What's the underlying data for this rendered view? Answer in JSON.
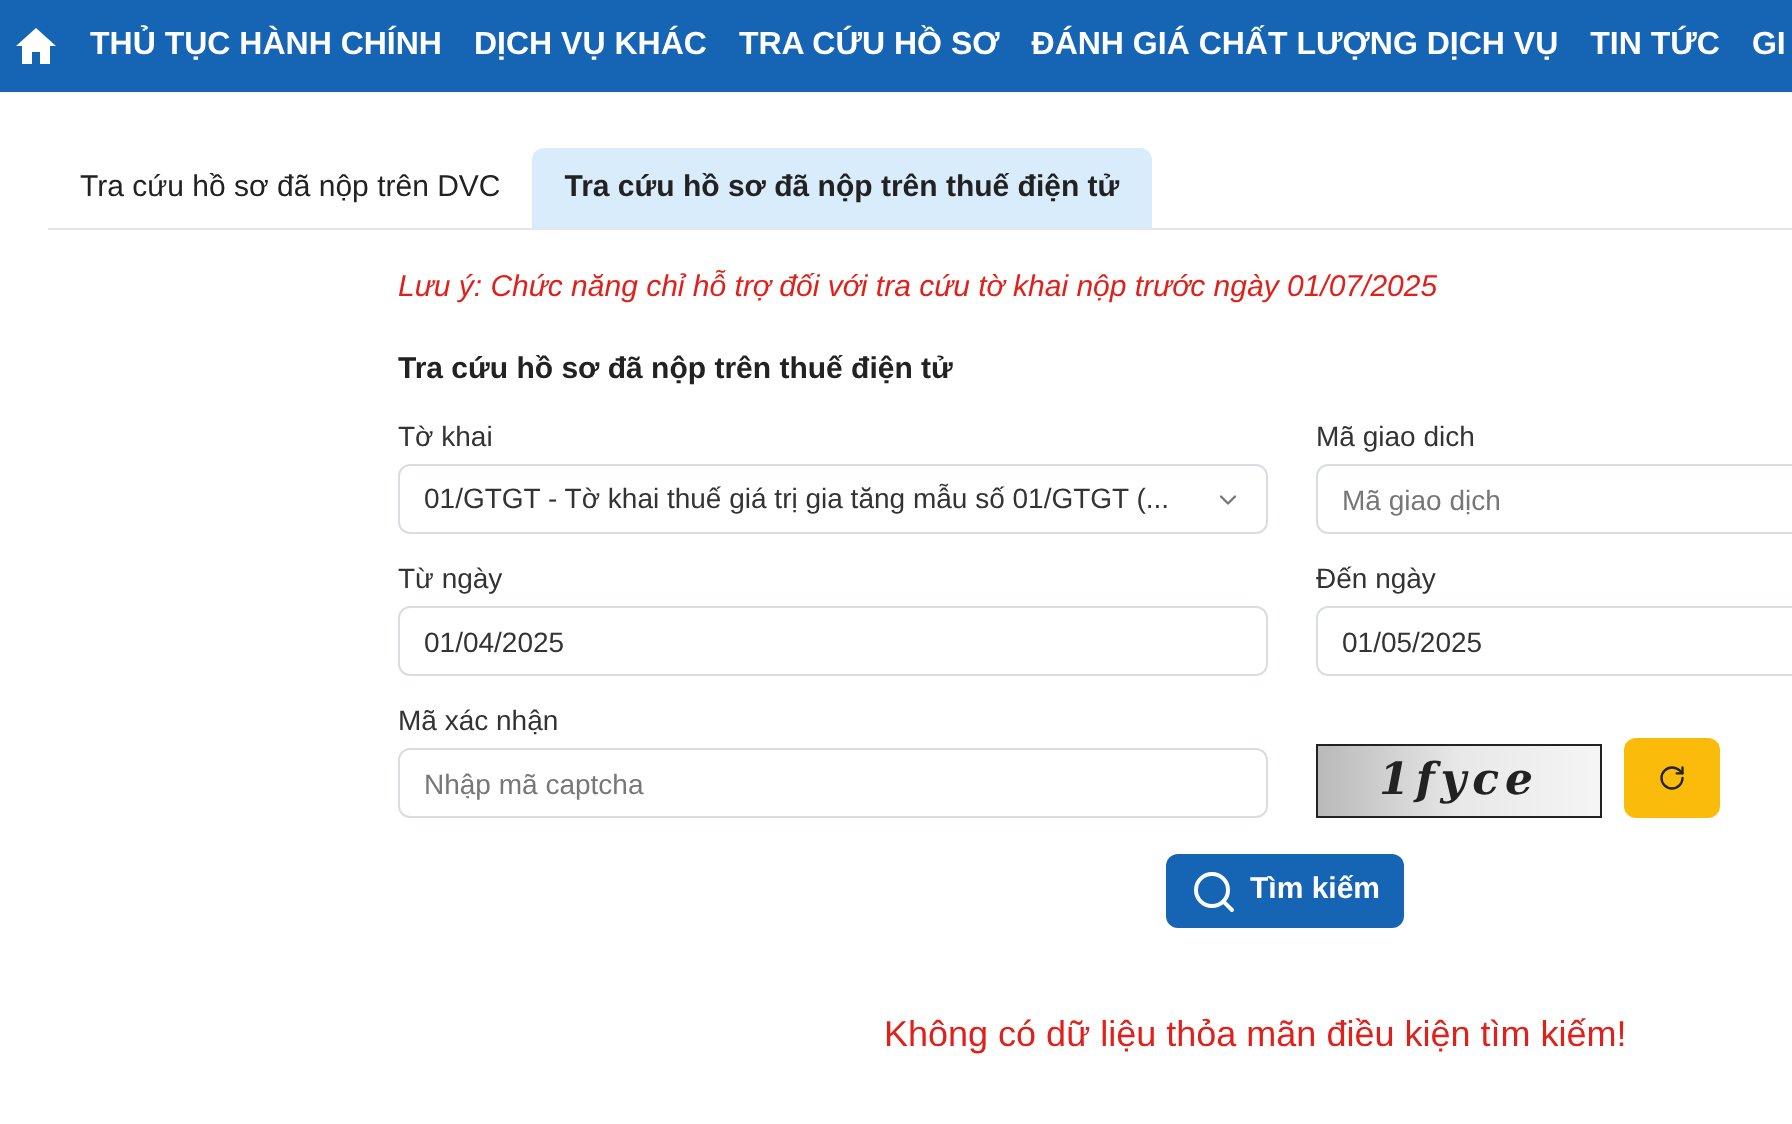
{
  "nav": {
    "items": [
      "THỦ TỤC HÀNH CHÍNH",
      "DỊCH VỤ KHÁC",
      "TRA CỨU HỒ SƠ",
      "ĐÁNH GIÁ CHẤT LƯỢNG DỊCH VỤ",
      "TIN TỨC",
      "GI"
    ]
  },
  "tabs": [
    {
      "label": "Tra cứu hồ sơ đã nộp trên DVC",
      "selected": false
    },
    {
      "label": "Tra cứu hồ sơ đã nộp trên thuế điện tử",
      "selected": true
    }
  ],
  "notice": "Lưu ý: Chức năng chỉ hỗ trợ đối với tra cứu tờ khai nộp trước ngày 01/07/2025",
  "form_title": "Tra cứu hồ sơ đã nộp trên thuế điện tử",
  "fields": {
    "declaration": {
      "label": "Tờ khai",
      "value": "01/GTGT - Tờ khai thuế giá trị gia tăng mẫu số 01/GTGT (..."
    },
    "transaction": {
      "label": "Mã giao dich",
      "placeholder": "Mã giao dịch"
    },
    "from_date": {
      "label": "Từ ngày",
      "value": "01/04/2025"
    },
    "to_date": {
      "label": "Đến ngày",
      "value": "01/05/2025"
    },
    "captcha": {
      "label": "Mã xác nhận",
      "placeholder": "Nhập mã captcha",
      "code": "1fyce"
    }
  },
  "search_button": "Tìm kiếm",
  "result_message": "Không có dữ liệu thỏa mãn điều kiện tìm kiếm!"
}
